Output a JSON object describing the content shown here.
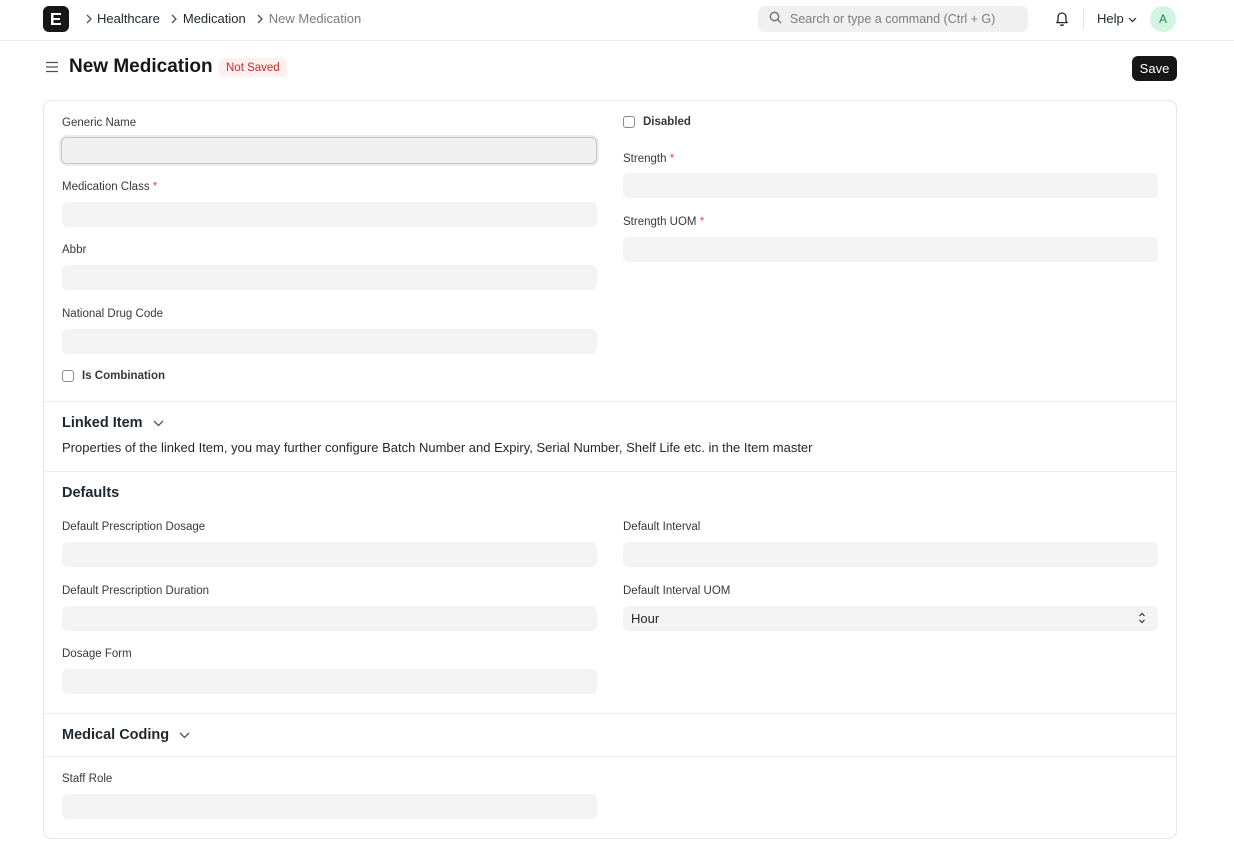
{
  "breadcrumb": [
    "Healthcare",
    "Medication",
    "New Medication"
  ],
  "search": {
    "placeholder": "Search or type a command (Ctrl + G)"
  },
  "navbar": {
    "help_label": "Help",
    "avatar_initial": "A"
  },
  "page": {
    "title": "New Medication",
    "status": "Not Saved",
    "save_label": "Save"
  },
  "form": {
    "generic_name": {
      "label": "Generic Name",
      "value": ""
    },
    "disabled": {
      "label": "Disabled",
      "checked": false
    },
    "strength": {
      "label": "Strength",
      "required_mark": "*",
      "value": ""
    },
    "medication_class": {
      "label": "Medication Class",
      "required_mark": "*",
      "value": ""
    },
    "strength_uom": {
      "label": "Strength UOM",
      "required_mark": "*",
      "value": ""
    },
    "abbr": {
      "label": "Abbr",
      "value": ""
    },
    "national_drug_code": {
      "label": "National Drug Code",
      "value": ""
    },
    "is_combination": {
      "label": "Is Combination",
      "checked": false
    }
  },
  "linked_item": {
    "title": "Linked Item",
    "description": "Properties of the linked Item, you may further configure Batch Number and Expiry, Serial Number, Shelf Life etc. in the Item master"
  },
  "defaults": {
    "title": "Defaults",
    "default_prescription_dosage": {
      "label": "Default Prescription Dosage",
      "value": ""
    },
    "default_interval": {
      "label": "Default Interval",
      "value": ""
    },
    "default_prescription_duration": {
      "label": "Default Prescription Duration",
      "value": ""
    },
    "default_interval_uom": {
      "label": "Default Interval UOM",
      "value": "Hour"
    },
    "dosage_form": {
      "label": "Dosage Form",
      "value": ""
    }
  },
  "medical_coding": {
    "title": "Medical Coding"
  },
  "staff": {
    "staff_role": {
      "label": "Staff Role",
      "value": ""
    }
  },
  "icons": [
    "app-logo-icon",
    "chevron-right-icon",
    "search-icon",
    "bell-icon",
    "chevron-down-icon",
    "hamburger-icon",
    "select-arrows-icon"
  ]
}
